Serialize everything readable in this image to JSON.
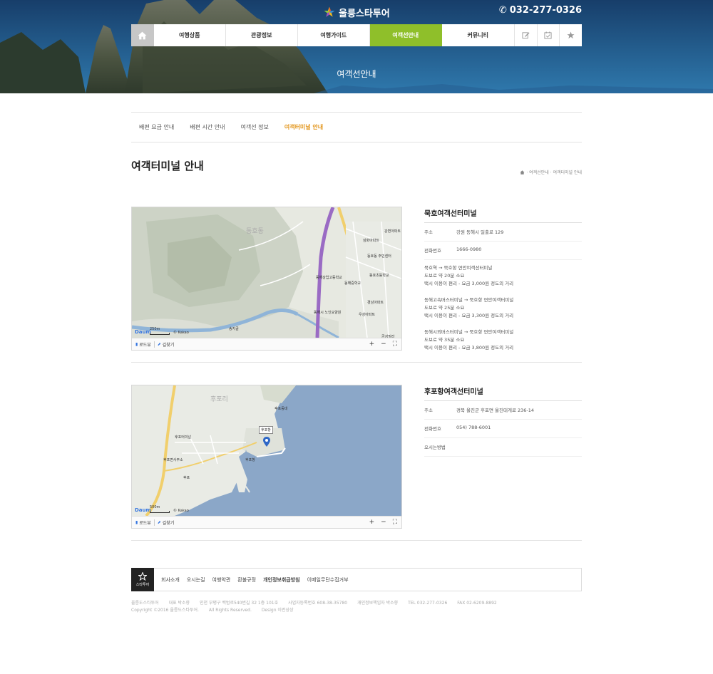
{
  "header": {
    "logo_text": "울릉스타투어",
    "phone": "032-277-0326",
    "hero_title": "여객선안내",
    "gnb": [
      {
        "label": "여행상품",
        "active": false
      },
      {
        "label": "관광정보",
        "active": false
      },
      {
        "label": "여행가이드",
        "active": false
      },
      {
        "label": "여객선안내",
        "active": true
      },
      {
        "label": "커뮤니티",
        "active": false
      }
    ],
    "util_icons": [
      "edit-icon",
      "calendar-check-icon",
      "star-icon"
    ]
  },
  "subnav": [
    {
      "label": "배편 요금 안내",
      "active": false
    },
    {
      "label": "배편 시간 안내",
      "active": false
    },
    {
      "label": "여객선 정보",
      "active": false
    },
    {
      "label": "여객터미널 안내",
      "active": true
    }
  ],
  "page_title": "여객터미널 안내",
  "breadcrumb": "· 여객선안내 · 여객터미널 안내",
  "terminals": [
    {
      "name": "묵호여객선터미널",
      "address_label": "주소",
      "address": "강원 동해시 일출로 129",
      "phone_label": "전화번호",
      "phone": "1666-0980",
      "directions": [
        [
          "묵호역 → 묵호항 연안여객선터미널",
          "도보로 약 20분 소요",
          "택시 이용이 편리 - 요금 3,000원 정도의 거리"
        ],
        [
          "동해고속버스터미널 → 묵호항 연안여객터미널",
          "도보로 약 25분 소요",
          "택시 이용이 편리 - 요금 3,300원 정도의 거리"
        ],
        [
          "동해시외버스터미널 → 묵호항 연안여객터미널",
          "도보로 약 35분 소요",
          "택시 이용이 편리 - 요금 3,800원 정도의 거리"
        ]
      ],
      "map": {
        "scale": "250m",
        "labels": [
          "동호동",
          "삼화아파트",
          "동호동 주민센터",
          "동해상업고등학교",
          "동해중학교",
          "동호초등학교",
          "경남아파트",
          "우성아파트",
          "동해시 노인요양원",
          "송지골",
          "강변아파트",
          "금성빌라"
        ]
      }
    },
    {
      "name": "후포항여객선터미널",
      "address_label": "주소",
      "address": "경북 울진군 후포면 울진대게로 236-14",
      "phone_label": "전화번호",
      "phone": "054) 788-6001",
      "directions_label": "오시는방법",
      "map": {
        "scale": "500m",
        "labels": [
          "후포리",
          "후포등대",
          "후포터미널",
          "후포항",
          "후포면사무소",
          "후포",
          "후포항"
        ]
      }
    }
  ],
  "map_bar": {
    "roadview": "로드뷰",
    "route": "길찾기",
    "zoom_in": "+",
    "zoom_out": "−",
    "fullscreen": "⛶",
    "brand": "Daum",
    "copyright": "© Kakao"
  },
  "footer": {
    "logo_text": "스타투어",
    "links": [
      {
        "label": "회사소개",
        "bold": false
      },
      {
        "label": "오시는길",
        "bold": false
      },
      {
        "label": "여행약관",
        "bold": false
      },
      {
        "label": "환불규정",
        "bold": false
      },
      {
        "label": "개인정보취급방침",
        "bold": true
      },
      {
        "label": "이메일무단수집거부",
        "bold": false
      }
    ],
    "info_line1": [
      "울릉도스타투어",
      "대표 박소향",
      "인천 부평구 백범로540번길 32 1층 101호",
      "사업자등록번호 608-38-35780",
      "개인정보책임자 박소향",
      "TEL 032-277-0326",
      "FAX 02-6209-8892"
    ],
    "copyright": "Copyright ©2016 울릉도스타투어.",
    "rights": "All Rights Reserved.",
    "design": "Design 이런상상"
  }
}
